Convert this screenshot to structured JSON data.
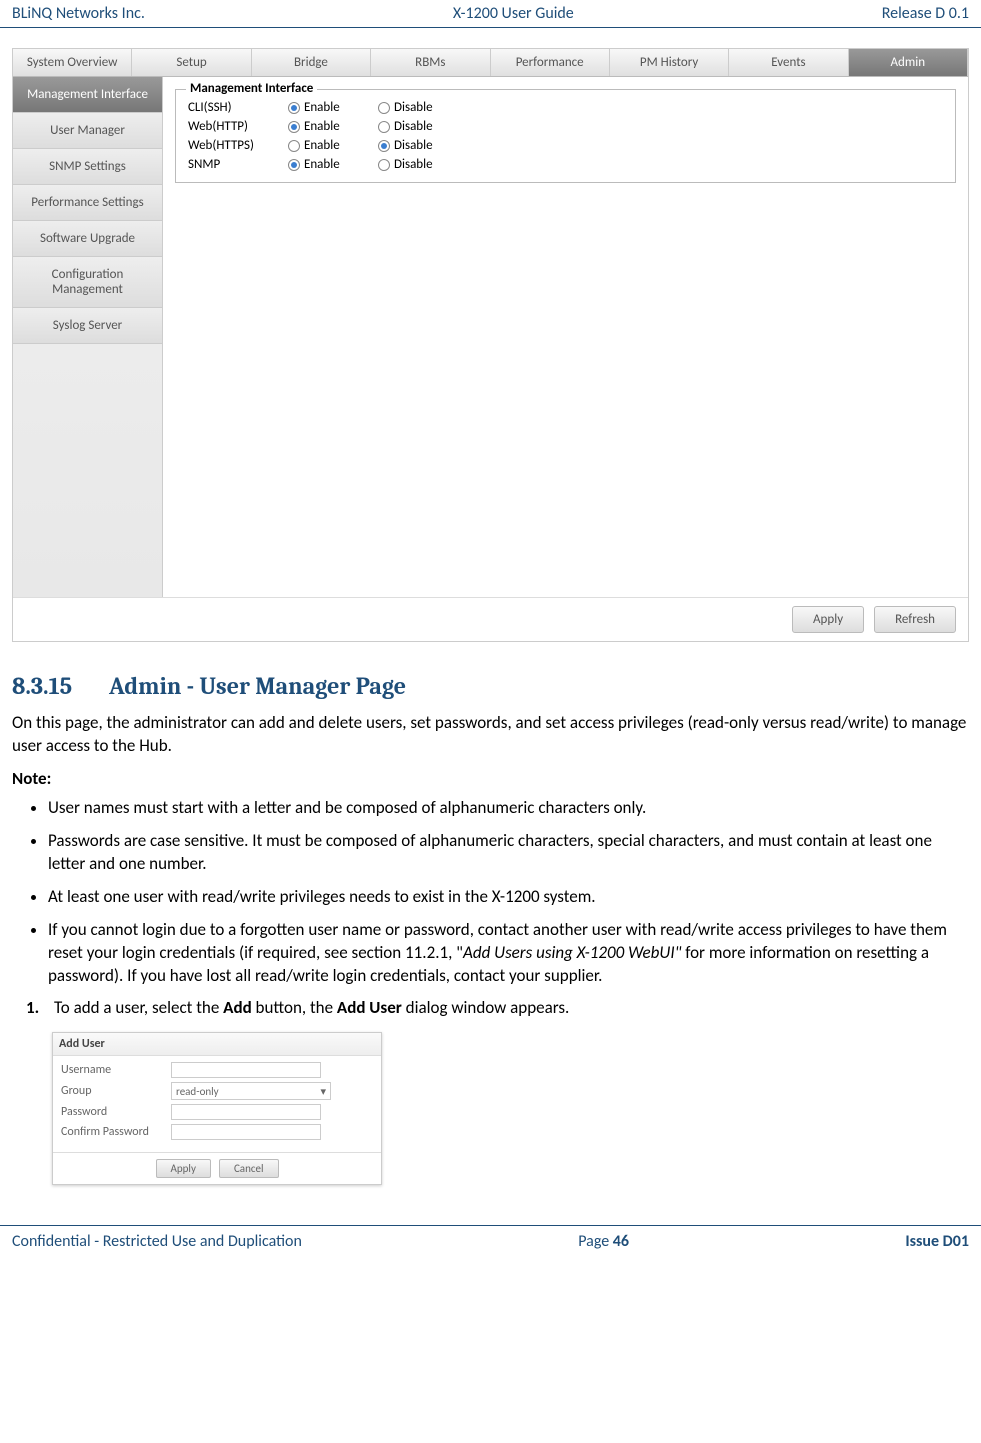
{
  "header": {
    "left": "BLiNQ Networks Inc.",
    "center": "X-1200 User Guide",
    "right": "Release D 0.1"
  },
  "top_tabs": [
    "System Overview",
    "Setup",
    "Bridge",
    "RBMs",
    "Performance",
    "PM History",
    "Events",
    "Admin"
  ],
  "active_top_tab": 7,
  "sidebar_items": [
    "Management Interface",
    "User Manager",
    "SNMP Settings",
    "Performance Settings",
    "Software Upgrade",
    "Configuration Management",
    "Syslog Server"
  ],
  "active_sidebar": 0,
  "fieldset_legend": "Management Interface",
  "config_rows": [
    {
      "label": "CLI(SSH)",
      "enable": true,
      "disable": false
    },
    {
      "label": "Web(HTTP)",
      "enable": true,
      "disable": false
    },
    {
      "label": "Web(HTTPS)",
      "enable": false,
      "disable": true
    },
    {
      "label": "SNMP",
      "enable": true,
      "disable": false
    }
  ],
  "radio_enable": "Enable",
  "radio_disable": "Disable",
  "apply_btn": "Apply",
  "refresh_btn": "Refresh",
  "section": {
    "number": "8.3.15",
    "title": "Admin - User Manager Page"
  },
  "intro": "On this page, the administrator can add and delete users, set passwords, and set access privileges (read-only versus read/write) to manage user access to the Hub.",
  "note_label": "Note:",
  "notes": [
    "User names must start with a letter and be composed of alphanumeric characters only.",
    "Passwords are case sensitive. It must be composed of alphanumeric characters, special characters, and must contain at least one letter and one number.",
    "At least one user with read/write privileges needs to exist in the X-1200 system."
  ],
  "note4_p1": "If you cannot login due to a forgotten user name or password, contact another user with read/write access privileges to have them reset your login credentials (if required, see section 11.2.1, \"",
  "note4_italic": "Add Users using X-1200 WebUI\"",
  "note4_p2": " for more information on resetting a password). If you have lost all read/write login credentials, contact your supplier.",
  "step1_num": "1.",
  "step1_p1": "To add a user, select the ",
  "step1_b1": "Add",
  "step1_p2": " button, the ",
  "step1_b2": "Add User",
  "step1_p3": " dialog window appears.",
  "dialog": {
    "title": "Add User",
    "username": "Username",
    "group": "Group",
    "group_value": "read-only",
    "password": "Password",
    "confirm": "Confirm Password",
    "apply": "Apply",
    "cancel": "Cancel"
  },
  "footer": {
    "left": "Confidential - Restricted Use and Duplication",
    "center_pre": "Page ",
    "center_num": "46",
    "right": "Issue D01"
  }
}
